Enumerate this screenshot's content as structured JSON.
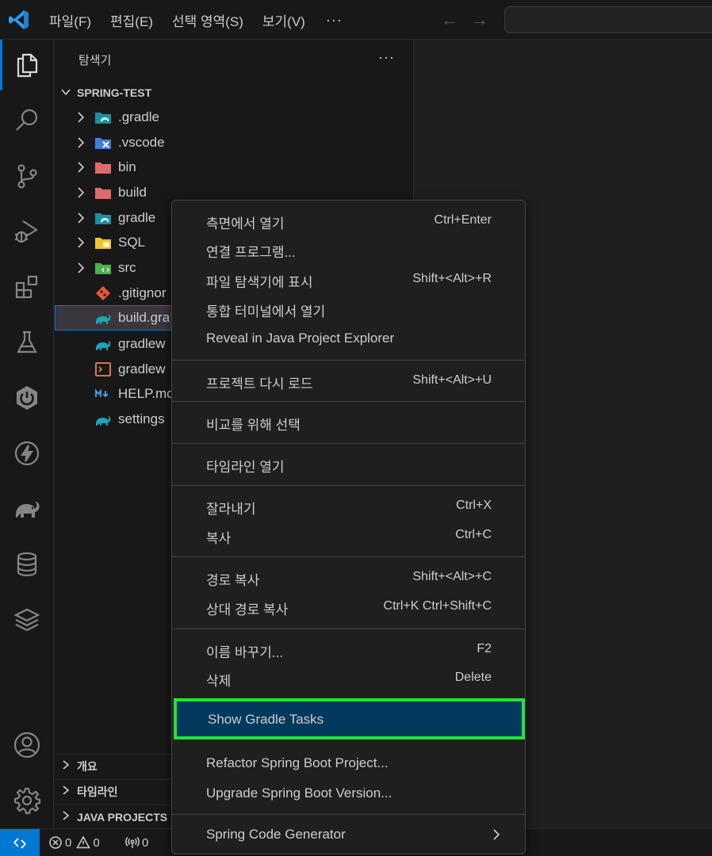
{
  "menu": {
    "items": [
      "파일(F)",
      "편집(E)",
      "선택 영역(S)",
      "보기(V)"
    ],
    "more": "···"
  },
  "nav": {
    "back": "←",
    "forward": "→"
  },
  "sidebar": {
    "title": "탐색기",
    "more": "···",
    "project": "SPRING-TEST",
    "tree": [
      {
        "label": ".gradle",
        "icon": "folder-gradle-icon"
      },
      {
        "label": ".vscode",
        "icon": "folder-vscode-icon"
      },
      {
        "label": "bin",
        "icon": "folder-bin-icon"
      },
      {
        "label": "build",
        "icon": "folder-build-icon"
      },
      {
        "label": "gradle",
        "icon": "folder-gradle-icon"
      },
      {
        "label": "SQL",
        "icon": "folder-sql-icon"
      },
      {
        "label": "src",
        "icon": "folder-src-icon"
      },
      {
        "label": ".gitignor",
        "icon": "git-icon"
      },
      {
        "label": "build.gra",
        "icon": "gradle-elephant-icon"
      },
      {
        "label": "gradlew",
        "icon": "gradle-elephant-icon"
      },
      {
        "label": "gradlew",
        "icon": "terminal-file-icon"
      },
      {
        "label": "HELP.mc",
        "icon": "markdown-icon"
      },
      {
        "label": "settings",
        "icon": "gradle-elephant-icon"
      }
    ],
    "bottom_sections": [
      "개요",
      "타임라인",
      "JAVA PROJECTS"
    ]
  },
  "context_menu": {
    "groups": [
      [
        {
          "label": "측면에서 열기",
          "key": "Ctrl+Enter"
        },
        {
          "label": "연결 프로그램...",
          "key": ""
        },
        {
          "label": "파일 탐색기에 표시",
          "key": "Shift+<Alt>+R"
        },
        {
          "label": "통합 터미널에서 열기",
          "key": ""
        },
        {
          "label": "Reveal in Java Project Explorer",
          "key": ""
        }
      ],
      [
        {
          "label": "프로젝트 다시 로드",
          "key": "Shift+<Alt>+U"
        }
      ],
      [
        {
          "label": "비교를 위해 선택",
          "key": ""
        }
      ],
      [
        {
          "label": "타임라인 열기",
          "key": ""
        }
      ],
      [
        {
          "label": "잘라내기",
          "key": "Ctrl+X"
        },
        {
          "label": "복사",
          "key": "Ctrl+C"
        }
      ],
      [
        {
          "label": "경로 복사",
          "key": "Shift+<Alt>+C"
        },
        {
          "label": "상대 경로 복사",
          "key": "Ctrl+K Ctrl+Shift+C"
        }
      ],
      [
        {
          "label": "이름 바꾸기...",
          "key": "F2"
        },
        {
          "label": "삭제",
          "key": "Delete"
        }
      ],
      [
        {
          "label": "Show Gradle Tasks",
          "key": ""
        }
      ],
      [
        {
          "label": "Refactor Spring Boot Project...",
          "key": ""
        },
        {
          "label": "Upgrade Spring Boot Version...",
          "key": ""
        }
      ],
      [
        {
          "label": "Spring Code Generator",
          "key": ""
        }
      ]
    ]
  },
  "status": {
    "errors": "0",
    "warnings": "0",
    "ports": "0"
  },
  "colors": {
    "accent": "#0078d4",
    "highlight_border": "#22e33a",
    "highlight_bg": "#04395e"
  }
}
